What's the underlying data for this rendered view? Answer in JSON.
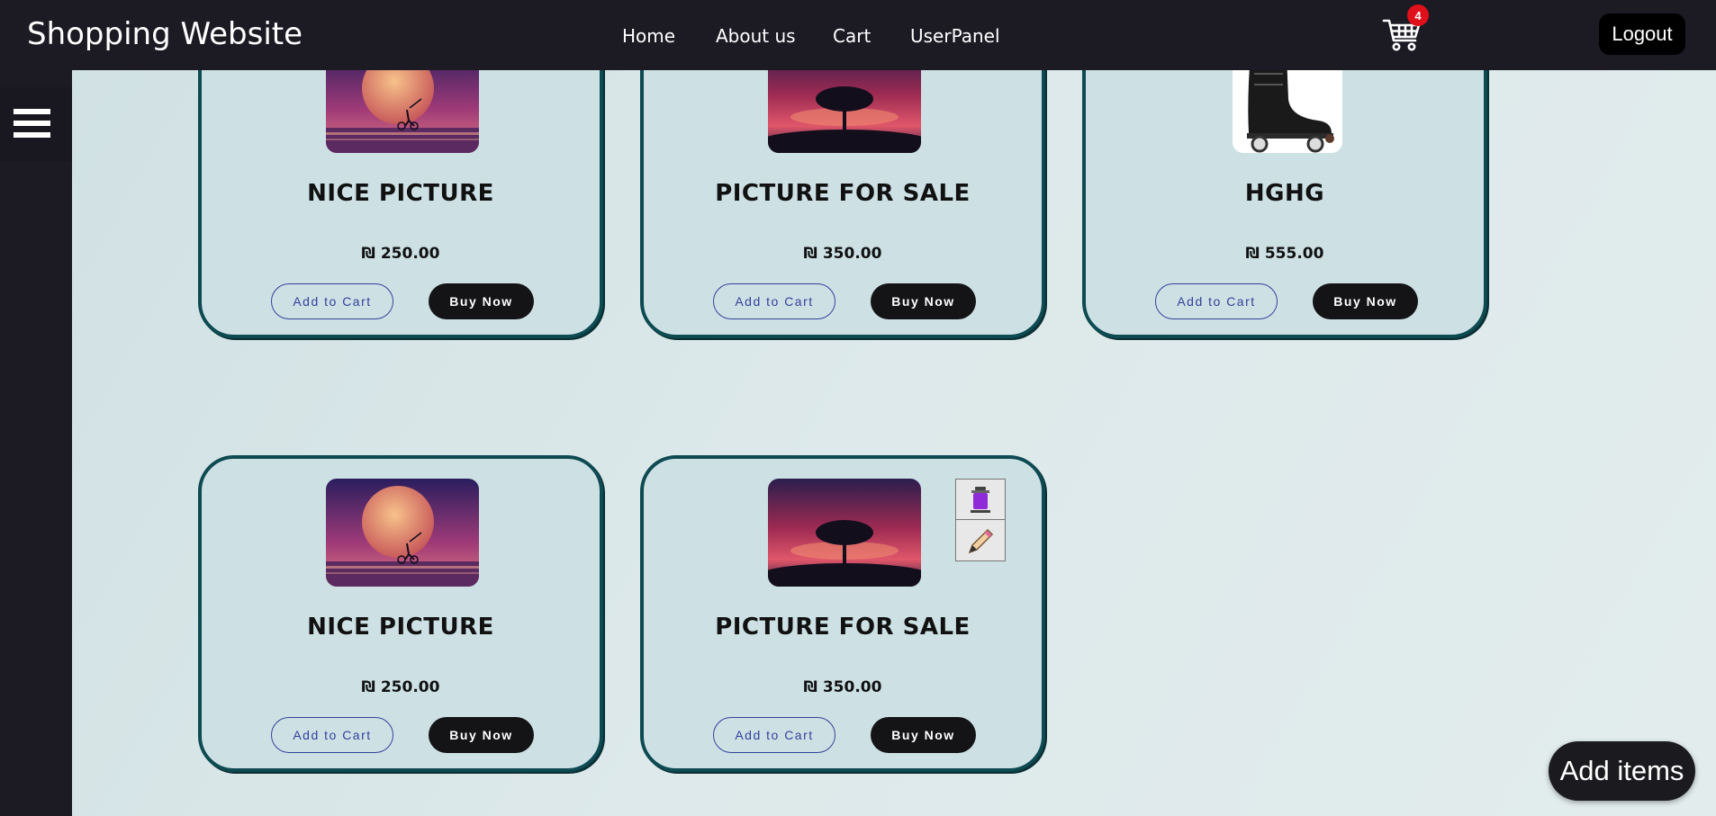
{
  "header": {
    "brand": "Shopping Website",
    "nav": [
      "Home",
      "About us",
      "Cart",
      "UserPanel"
    ],
    "cart_count": "4",
    "logout_label": "Logout"
  },
  "products": [
    {
      "title": "NICE PICTURE",
      "price": "₪ 250.00",
      "image": "moon-cyclist-image",
      "add_label": "Add to Cart",
      "buy_label": "Buy Now",
      "admin_tools": false
    },
    {
      "title": "PICTURE FOR SALE",
      "price": "₪ 350.00",
      "image": "tree-sunset-image",
      "add_label": "Add to Cart",
      "buy_label": "Buy Now",
      "admin_tools": true
    },
    {
      "title": "HGHG",
      "price": "₪ 555.00",
      "image": "roller-skate-image",
      "add_label": "Add to Cart",
      "buy_label": "Buy Now",
      "admin_tools": false
    },
    {
      "title": "NICE PICTURE",
      "price": "₪ 250.00",
      "image": "moon-cyclist-image",
      "add_label": "Add to Cart",
      "buy_label": "Buy Now",
      "admin_tools": false
    },
    {
      "title": "PICTURE FOR SALE",
      "price": "₪ 350.00",
      "image": "tree-sunset-image",
      "add_label": "Add to Cart",
      "buy_label": "Buy Now",
      "admin_tools": true
    }
  ],
  "add_items_label": "Add items",
  "icons": {
    "menu": "hamburger-menu-icon",
    "cart": "shopping-cart-icon",
    "delete": "trash-icon",
    "edit": "pencil-icon"
  },
  "colors": {
    "navbar": "#1c1b24",
    "card_bg": "#cde1e5",
    "card_border": "#0d4a52",
    "badge": "#e0101a",
    "button_dark": "#141416",
    "outline_button": "#33409a"
  }
}
